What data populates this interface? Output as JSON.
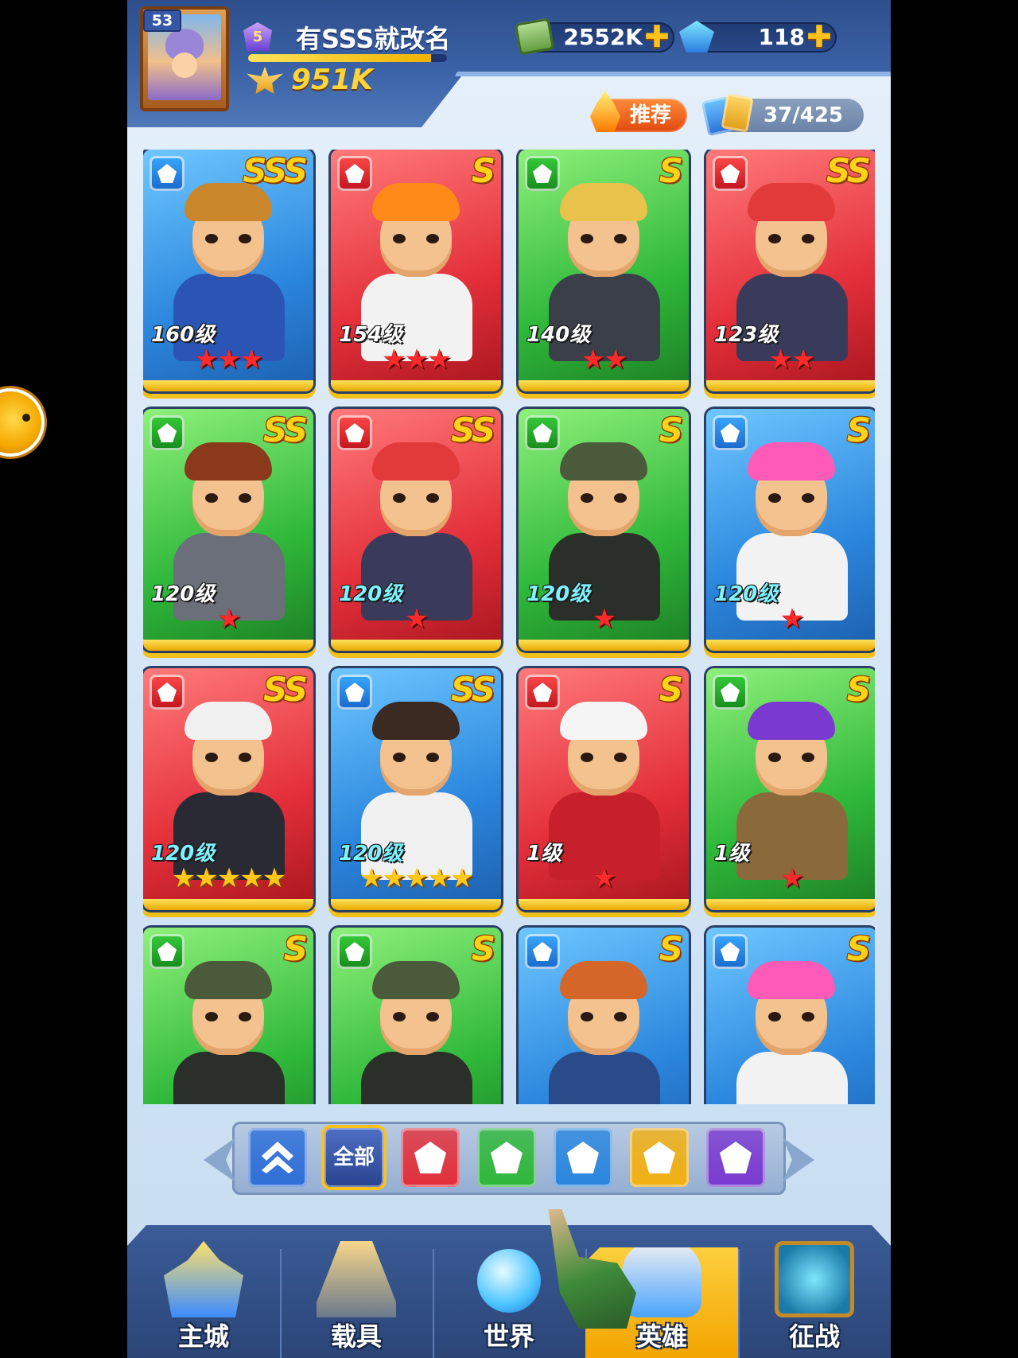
{
  "player": {
    "level": "53",
    "rank": "5",
    "name": "有SSS就改名",
    "xp_fill_percent": 92,
    "power": "951K"
  },
  "resources": {
    "cash": "2552K",
    "gems": "118",
    "plus": "✚"
  },
  "subheader": {
    "recommend_label": "推荐",
    "card_count": "37/425"
  },
  "heroes": [
    {
      "color": "blue",
      "rarity": "SSS",
      "level": "160级",
      "level_style": "white",
      "stars": 3,
      "star_color": "red",
      "hair": "#c9862a",
      "body": "#2a55b5"
    },
    {
      "color": "red",
      "rarity": "S",
      "level": "154级",
      "level_style": "white",
      "stars": 3,
      "star_color": "red",
      "hair": "#ff8a1a",
      "body": "#f2f2f2"
    },
    {
      "color": "green",
      "rarity": "S",
      "level": "140级",
      "level_style": "white",
      "stars": 2,
      "star_color": "red",
      "hair": "#e8c24a",
      "body": "#3a3f4a"
    },
    {
      "color": "red",
      "rarity": "SS",
      "level": "123级",
      "level_style": "white",
      "stars": 2,
      "star_color": "red",
      "hair": "#e23a3a",
      "body": "#3a3a5a"
    },
    {
      "color": "green",
      "rarity": "SS",
      "level": "120级",
      "level_style": "white",
      "stars": 1,
      "star_color": "red",
      "hair": "#8a3a1a",
      "body": "#6a6f7a"
    },
    {
      "color": "red",
      "rarity": "SS",
      "level": "120级",
      "level_style": "cyan",
      "stars": 1,
      "star_color": "red",
      "hair": "#e23a3a",
      "body": "#3a3a5a"
    },
    {
      "color": "green",
      "rarity": "S",
      "level": "120级",
      "level_style": "cyan",
      "stars": 1,
      "star_color": "red",
      "hair": "#4a5a3a",
      "body": "#2a2f2a"
    },
    {
      "color": "blue",
      "rarity": "S",
      "level": "120级",
      "level_style": "cyan",
      "stars": 1,
      "star_color": "red",
      "hair": "#ff5ab8",
      "body": "#f2f2f2"
    },
    {
      "color": "red",
      "rarity": "SS",
      "level": "120级",
      "level_style": "cyan",
      "stars": 5,
      "star_color": "gold",
      "hair": "#f0f0f0",
      "body": "#2a2a35"
    },
    {
      "color": "blue",
      "rarity": "SS",
      "level": "120级",
      "level_style": "cyan",
      "stars": 5,
      "star_color": "gold",
      "hair": "#3a2a22",
      "body": "#f0f0f0"
    },
    {
      "color": "red",
      "rarity": "S",
      "level": "1级",
      "level_style": "white",
      "stars": 1,
      "star_color": "red",
      "hair": "#f5f5f5",
      "body": "#c8202a"
    },
    {
      "color": "green",
      "rarity": "S",
      "level": "1级",
      "level_style": "white",
      "stars": 1,
      "star_color": "red",
      "hair": "#7a3ad0",
      "body": "#8a6a3a"
    },
    {
      "color": "green",
      "rarity": "S",
      "level": "",
      "level_style": "white",
      "stars": 0,
      "star_color": "red",
      "hair": "#4a5a3a",
      "body": "#2a2f2a"
    },
    {
      "color": "green",
      "rarity": "S",
      "level": "",
      "level_style": "white",
      "stars": 0,
      "star_color": "red",
      "hair": "#4a5a3a",
      "body": "#2a2f2a"
    },
    {
      "color": "blue",
      "rarity": "S",
      "level": "",
      "level_style": "white",
      "stars": 0,
      "star_color": "red",
      "hair": "#d4662a",
      "body": "#2a4a8a"
    },
    {
      "color": "blue",
      "rarity": "S",
      "level": "",
      "level_style": "white",
      "stars": 0,
      "star_color": "red",
      "hair": "#ff5ab8",
      "body": "#f2f2f2"
    }
  ],
  "filters": {
    "all_label": "全部",
    "buttons": [
      {
        "name": "filter-sort",
        "icon": "chevron-up-icon",
        "color": "#2e6fd8"
      },
      {
        "name": "filter-all",
        "icon": "",
        "color": "#2a438e"
      },
      {
        "name": "filter-red",
        "icon": "red-class-icon",
        "color": "#e32f3a"
      },
      {
        "name": "filter-green",
        "icon": "green-class-icon",
        "color": "#2fb83a"
      },
      {
        "name": "filter-blue",
        "icon": "blue-class-icon",
        "color": "#2b86dd"
      },
      {
        "name": "filter-gold",
        "icon": "gold-class-icon",
        "color": "#f3b010"
      },
      {
        "name": "filter-purple",
        "icon": "purple-class-icon",
        "color": "#7a3ad0"
      }
    ]
  },
  "nav": {
    "city": "主城",
    "vehicle": "载具",
    "world": "世界",
    "hero": "英雄",
    "campaign": "征战",
    "active": "hero"
  }
}
